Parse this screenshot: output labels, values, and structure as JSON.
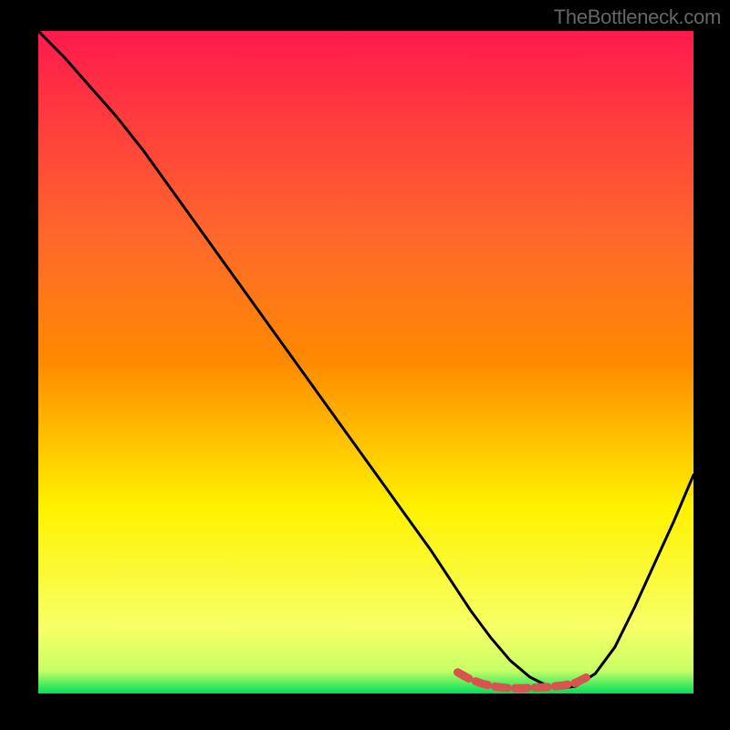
{
  "watermark": "TheBottleneck.com",
  "chart_data": {
    "type": "line",
    "title": "",
    "xlabel": "",
    "ylabel": "",
    "xlim": [
      0,
      100
    ],
    "ylim": [
      0,
      100
    ],
    "background_gradient": {
      "top": "#ff1a4d",
      "upper_mid": "#ff8a00",
      "lower_mid": "#fff200",
      "near_bottom": "#f7ff66",
      "bottom": "#00e05a"
    },
    "series": [
      {
        "name": "bottleneck-curve",
        "color": "#000000",
        "x": [
          0,
          4,
          8,
          12,
          16,
          20,
          24,
          28,
          32,
          36,
          40,
          44,
          48,
          52,
          56,
          60,
          63,
          66,
          69,
          72,
          75,
          78,
          80,
          82,
          85,
          88,
          91,
          94,
          97,
          100
        ],
        "y": [
          100,
          96,
          91.5,
          87,
          82,
          76.5,
          71,
          65.5,
          60,
          54.5,
          49,
          43.5,
          38,
          32.5,
          27,
          21.5,
          17,
          12.5,
          8.5,
          5,
          2.5,
          1,
          0.8,
          1.1,
          3,
          7,
          13,
          19.5,
          26,
          33
        ]
      },
      {
        "name": "optimal-range-marker",
        "color": "#d9534f",
        "style": "dashed-thick",
        "x": [
          64,
          66,
          68,
          70,
          72,
          74,
          76,
          78,
          80,
          82,
          84
        ],
        "y": [
          3.2,
          2.1,
          1.4,
          1.0,
          0.8,
          0.8,
          0.9,
          1.0,
          1.2,
          1.6,
          2.6
        ]
      }
    ]
  }
}
